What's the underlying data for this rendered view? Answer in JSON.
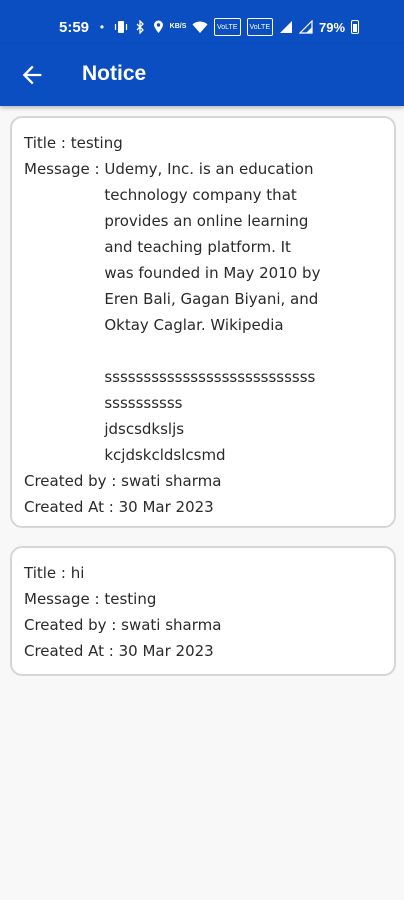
{
  "status_bar": {
    "time": "5:59",
    "dot": "•",
    "battery": "79%",
    "icons": [
      "vibrate-icon",
      "bluetooth-icon",
      "location-icon",
      "data-speed-icon",
      "wifi-icon",
      "volte-icon",
      "volte-icon",
      "signal-icon",
      "signal-icon",
      "battery-icon"
    ],
    "speed_text": "KB/S",
    "volte1": "VoLTE",
    "volte2": "VoLTE"
  },
  "app_bar": {
    "title": "Notice"
  },
  "notices": [
    {
      "title_label": "Title : ",
      "title": "testing",
      "message_label": "Message : ",
      "message": "Udemy, Inc. is an education\ntechnology company that\nprovides an online learning\nand teaching platform. It\nwas founded in May 2010 by\nEren Bali, Gagan Biyani, and\nOktay Caglar. Wikipedia\n\nsssssssssssssssssssssssssss\nssssssssss\njdscsdksljs\nkcjdskcldslcsmd",
      "created_by_label": "Created by : ",
      "created_by": "swati sharma",
      "created_at_label": "Created At : ",
      "created_at": "30 Mar 2023"
    },
    {
      "title_label": "Title : ",
      "title": "hi",
      "message_label": "Message : ",
      "message": "testing",
      "created_by_label": "Created by : ",
      "created_by": "swati sharma",
      "created_at_label": "Created At : ",
      "created_at": "30 Mar 2023"
    }
  ],
  "colors": {
    "primary": "#0a4ec2",
    "background": "#f8f8f8",
    "card_border": "#d6d6d6"
  }
}
